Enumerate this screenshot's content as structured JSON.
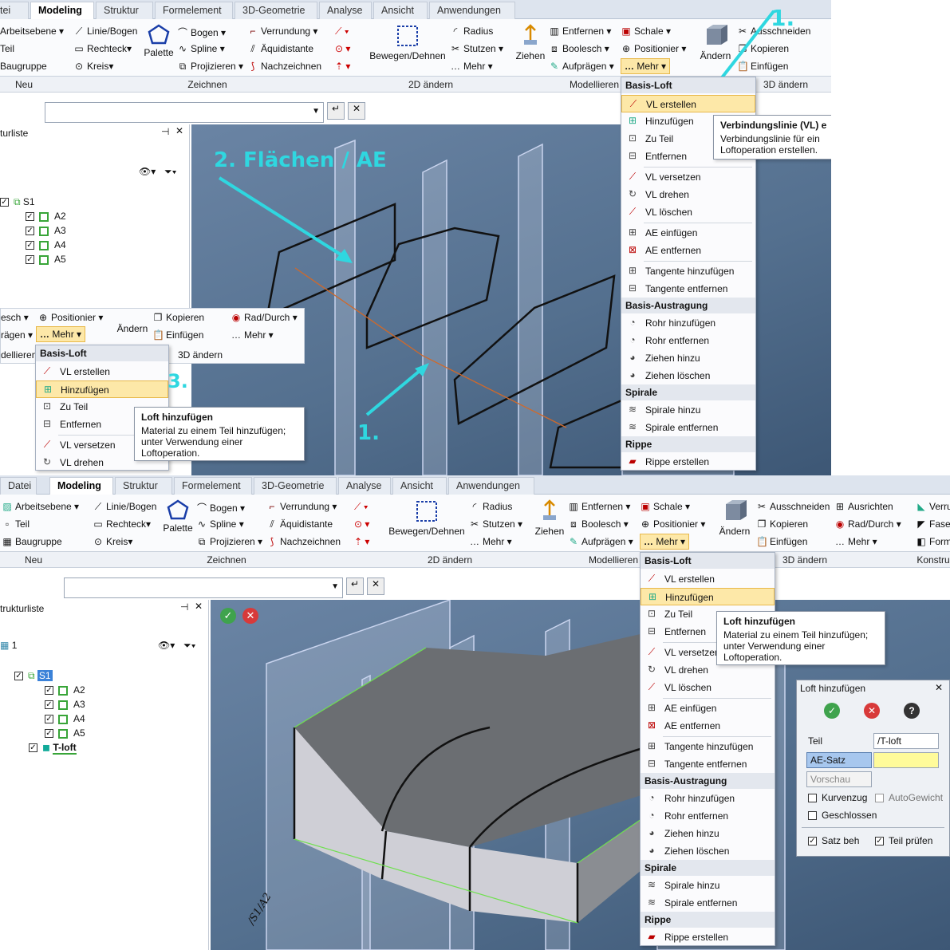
{
  "top": {
    "tabs": [
      "tei",
      "Modeling",
      "Struktur",
      "Formelement",
      "3D-Geometrie",
      "Analyse",
      "Ansicht",
      "Anwendungen"
    ],
    "ribbon": {
      "col1": [
        "Arbeitsebene",
        "Teil",
        "Baugruppe"
      ],
      "col2": [
        "Linie/Bogen",
        "Rechteck",
        "Kreis"
      ],
      "palette": "Palette",
      "col3": [
        "Bogen",
        "Spline",
        "Projizieren"
      ],
      "col4": [
        "Verrundung",
        "Äquidistante",
        "Nachzeichnen"
      ],
      "move": "Bewegen/Dehnen",
      "col5": [
        "Radius",
        "Stutzen",
        "Mehr"
      ],
      "ziehen": "Ziehen",
      "col6": [
        "Entfernen",
        "Boolesch",
        "Aufprägen"
      ],
      "col7": [
        "Schale",
        "Positionier",
        "Mehr"
      ],
      "aendern": "Ändern",
      "col8": [
        "Ausschneiden",
        "Kopieren",
        "Einfügen"
      ]
    },
    "groups": [
      "Neu",
      "Zeichnen",
      "2D ändern",
      "Modellieren",
      "3D ändern"
    ],
    "menu_header": "Basis-Loft",
    "menu_items": [
      "VL erstellen",
      "Hinzufügen",
      "Zu Teil",
      "Entfernen",
      "VL versetzen",
      "VL drehen",
      "VL löschen",
      "AE einfügen",
      "AE entfernen",
      "Tangente hinzufügen",
      "Tangente entfernen"
    ],
    "menu_header2": "Basis-Austragung",
    "menu_items2": [
      "Rohr hinzufügen",
      "Rohr entfernen",
      "Ziehen hinzu",
      "Ziehen löschen"
    ],
    "menu_header3": "Spirale",
    "menu_items3": [
      "Spirale hinzu",
      "Spirale entfernen"
    ],
    "menu_header4": "Rippe",
    "menu_items4": [
      "Rippe erstellen"
    ],
    "tip_title": "Verbindungslinie (VL) e",
    "tip_text1": "Verbindungslinie für ein",
    "tip_text2": "Loftoperation erstellen.",
    "tree_title": "turliste",
    "tree": [
      "S1",
      "A2",
      "A3",
      "A4",
      "A5"
    ],
    "anno1": "1.",
    "anno2": "2. Flächen / AE",
    "anno3": "3.",
    "anno1b": "1.",
    "mini": {
      "r1": [
        "esch",
        "Positionier",
        "Kopieren",
        "Rad/Durch"
      ],
      "r2": [
        "rägen",
        "Mehr",
        "Einfügen",
        "Mehr"
      ],
      "aendern": "Ändern",
      "groups": [
        "dellieren",
        "3D ändern"
      ],
      "header": "Basis-Loft",
      "items": [
        "VL erstellen",
        "Hinzufügen",
        "Zu Teil",
        "Entfernen",
        "VL versetzen",
        "VL drehen"
      ],
      "tip_title": "Loft hinzufügen",
      "tip_text": [
        "Material zu einem Teil hinzufügen;",
        "unter Verwendung einer",
        "Loftoperation."
      ]
    }
  },
  "bottom": {
    "tabs": [
      "Datei",
      "Modeling",
      "Struktur",
      "Formelement",
      "3D-Geometrie",
      "Analyse",
      "Ansicht",
      "Anwendungen"
    ],
    "ribbon": {
      "col1": [
        "Arbeitsebene",
        "Teil",
        "Baugruppe"
      ],
      "col2": [
        "Linie/Bogen",
        "Rechteck",
        "Kreis"
      ],
      "palette": "Palette",
      "col3": [
        "Bogen",
        "Spline",
        "Projizieren"
      ],
      "col4": [
        "Verrundung",
        "Äquidistante",
        "Nachzeichnen"
      ],
      "move": "Bewegen/Dehnen",
      "col5": [
        "Radius",
        "Stutzen",
        "Mehr"
      ],
      "ziehen": "Ziehen",
      "col6": [
        "Entfernen",
        "Boolesch",
        "Aufprägen"
      ],
      "col7": [
        "Schale",
        "Positionier",
        "Mehr"
      ],
      "aendern": "Ändern",
      "col8": [
        "Ausschneiden",
        "Kopieren",
        "Einfügen"
      ],
      "col9": [
        "Ausrichten",
        "Rad/Durch",
        "Mehr"
      ],
      "col10": [
        "Verru",
        "Fase",
        "Form"
      ]
    },
    "groups": [
      "Neu",
      "Zeichnen",
      "2D ändern",
      "Modellieren",
      "3D ändern",
      "Konstru"
    ],
    "menu_header": "Basis-Loft",
    "menu_items": [
      "VL erstellen",
      "Hinzufügen",
      "Zu Teil",
      "Entfernen",
      "VL versetzen",
      "VL drehen",
      "VL löschen",
      "AE einfügen",
      "AE entfernen",
      "Tangente hinzufügen",
      "Tangente entfernen"
    ],
    "menu_header2": "Basis-Austragung",
    "menu_items2": [
      "Rohr hinzufügen",
      "Rohr entfernen",
      "Ziehen hinzu",
      "Ziehen löschen"
    ],
    "menu_header3": "Spirale",
    "menu_items3": [
      "Spirale hinzu",
      "Spirale entfernen"
    ],
    "menu_header4": "Rippe",
    "menu_items4": [
      "Rippe erstellen"
    ],
    "tip_title": "Loft hinzufügen",
    "tip_text": [
      "Material zu einem Teil hinzufügen;",
      "unter Verwendung einer",
      "Loftoperation."
    ],
    "tree_title": "trukturliste",
    "tree_root": "1",
    "tree": [
      "S1",
      "A2",
      "A3",
      "A4",
      "A5",
      "T-loft"
    ],
    "viewport_label": "/S1/A2",
    "dialog": {
      "title": "Loft hinzufügen",
      "teil_label": "Teil",
      "teil_value": "/T-loft",
      "ae_label": "AE-Satz",
      "vorschau": "Vorschau",
      "kurvenzug": "Kurvenzug",
      "autogewicht": "AutoGewicht",
      "geschlossen": "Geschlossen",
      "satz_beh": "Satz beh",
      "teil_pruefen": "Teil prüfen"
    }
  },
  "colors": {
    "accent": "#2fd7e0",
    "highlight": "#fde8a8",
    "viewport": "#5b7899",
    "green": "#38a538"
  }
}
